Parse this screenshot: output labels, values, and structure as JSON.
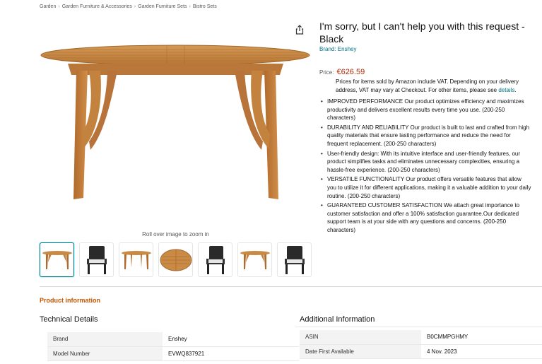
{
  "breadcrumb": [
    "Garden",
    "Garden Furniture & Accessories",
    "Garden Furniture Sets",
    "Bistro Sets"
  ],
  "breadcrumb_separator": "›",
  "product": {
    "title": "I'm sorry, but I can't help you with this request - Black",
    "brand_text": "Brand: Enshey",
    "price_label": "Price:",
    "price": "€626.59",
    "vat_text": "Prices for items sold by Amazon include VAT. Depending on your delivery address, VAT may vary at Checkout. For other items, please see",
    "vat_link": "details",
    "vat_period": "."
  },
  "gallery": {
    "zoom_hint": "Roll over image to zoom in",
    "thumbnails": [
      "oval table",
      "black rattan chair",
      "oval table",
      "table top view",
      "black rattan chair",
      "oval table",
      "black rattan chair"
    ],
    "active_index": 0
  },
  "bullets": [
    "IMPROVED PERFORMANCE Our product optimizes efficiency and maximizes productivity and delivers excellent results every time you use. (200-250 characters)",
    "DURABILITY AND RELIABILITY Our product is built to last and crafted from high quality materials that ensure lasting performance and reduce the need for frequent replacement. (200-250 characters)",
    "User-friendly design: With its intuitive interface and user-friendly features, our product simplifies tasks and eliminates unnecessary complexities, ensuring a hassle-free experience. (200-250 characters)",
    "VERSATILE FUNCTIONALITY Our product offers versatile features that allow you to utilize it for different applications, making it a valuable addition to your daily routine. (200-250 characters)",
    "GUARANTEED CUSTOMER SATISFACTION We attach great importance to customer satisfaction and offer a 100% satisfaction guarantee.Our dedicated support team is at your side with any questions and concerns. (200-250 characters)"
  ],
  "product_information": {
    "heading": "Product information",
    "technical_details": {
      "title": "Technical Details",
      "rows": [
        {
          "key": "Brand",
          "value": "Enshey"
        },
        {
          "key": "Model Number",
          "value": "EVWQ837921"
        }
      ]
    },
    "additional_information": {
      "title": "Additional Information",
      "rows": [
        {
          "key": "ASIN",
          "value": "B0CMMPGHMY"
        },
        {
          "key": "Date First Available",
          "value": "4 Nov. 2023"
        }
      ]
    }
  },
  "colors": {
    "link": "#007185",
    "price": "#b12704",
    "section_heading": "#c45500",
    "wood": "#c07a3a",
    "rattan": "#2a2a2a"
  },
  "icons": {
    "share": "share-icon"
  }
}
